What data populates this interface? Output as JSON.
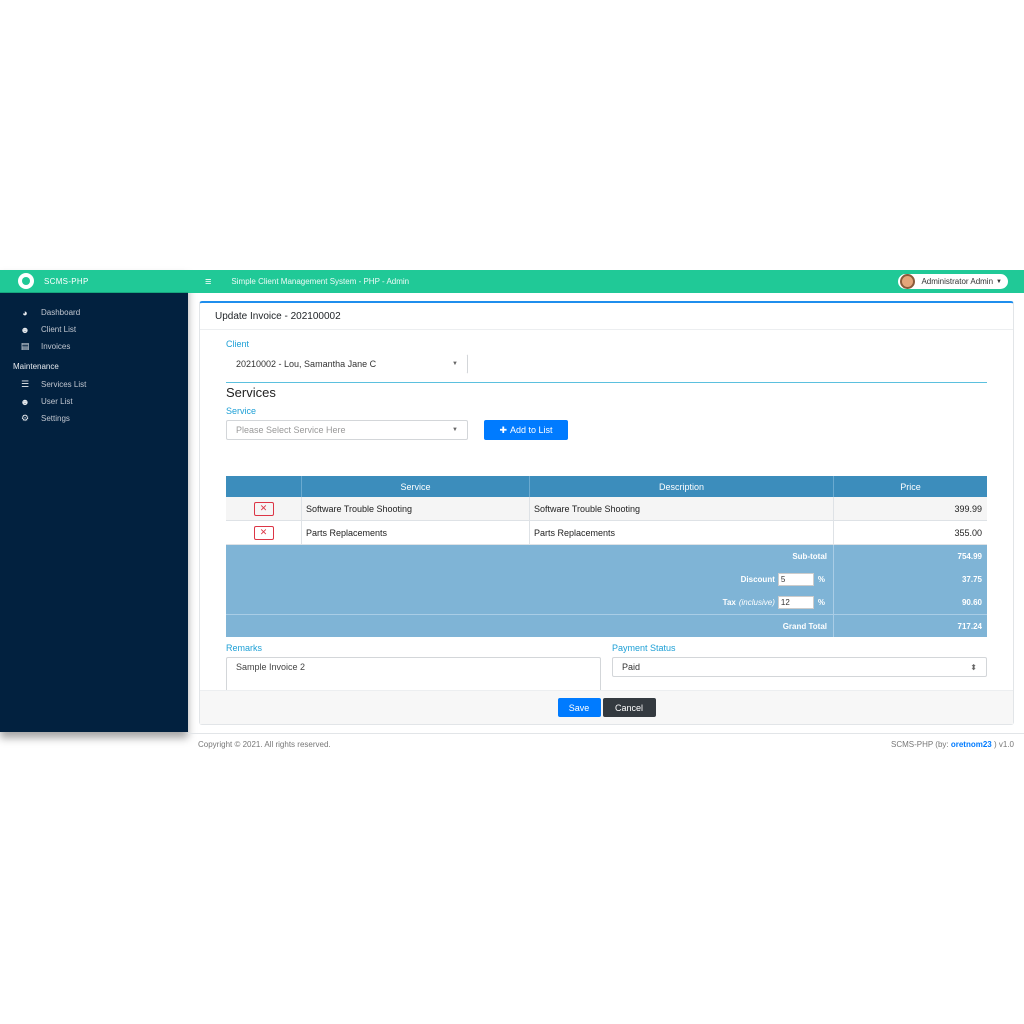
{
  "brand": {
    "name": "SCMS-PHP"
  },
  "topbar": {
    "title": "Simple Client Management System - PHP - Admin",
    "user": "Administrator Admin"
  },
  "sidebar": {
    "items": [
      {
        "label": "Dashboard",
        "icon": "tachometer-icon"
      },
      {
        "label": "Client List",
        "icon": "users-icon"
      },
      {
        "label": "Invoices",
        "icon": "file-invoice-icon"
      }
    ],
    "section": "Maintenance",
    "maint_items": [
      {
        "label": "Services List",
        "icon": "list-icon"
      },
      {
        "label": "User List",
        "icon": "users-cog-icon"
      },
      {
        "label": "Settings",
        "icon": "cogs-icon"
      }
    ]
  },
  "card": {
    "title": "Update Invoice - 202100002"
  },
  "client": {
    "label": "Client",
    "value": "20210002 - Lou, Samantha Jane C"
  },
  "services": {
    "title": "Services",
    "label": "Service",
    "placeholder": "Please Select Service Here",
    "add_button": "Add to List",
    "headers": [
      "Service",
      "Description",
      "Price"
    ],
    "rows": [
      {
        "service": "Software Trouble Shooting",
        "description": "Software Trouble Shooting",
        "price": "399.99"
      },
      {
        "service": "Parts Replacements",
        "description": "Parts Replacements",
        "price": "355.00"
      }
    ],
    "subtotal_label": "Sub-total",
    "subtotal": "754.99",
    "discount_label": "Discount",
    "discount_pct": "5",
    "discount": "37.75",
    "tax_label": "Tax",
    "tax_note": "(inclusive)",
    "tax_pct": "12",
    "tax": "90.60",
    "grand_label": "Grand Total",
    "grand": "717.24",
    "pct_sign": "%"
  },
  "remarks": {
    "label": "Remarks",
    "value": "Sample Invoice 2"
  },
  "payment": {
    "label": "Payment Status",
    "value": "Paid"
  },
  "buttons": {
    "save": "Save",
    "cancel": "Cancel"
  },
  "footer": {
    "copyright": "Copyright © 2021. All rights reserved.",
    "credit_prefix": "SCMS-PHP (by: ",
    "credit_link": "oretnom23",
    "credit_suffix": " ) v1.0"
  },
  "colors": {
    "accent": "#20c997",
    "sidebar": "#02213f",
    "primary": "#007bff",
    "table_header": "#3c8dbc"
  }
}
